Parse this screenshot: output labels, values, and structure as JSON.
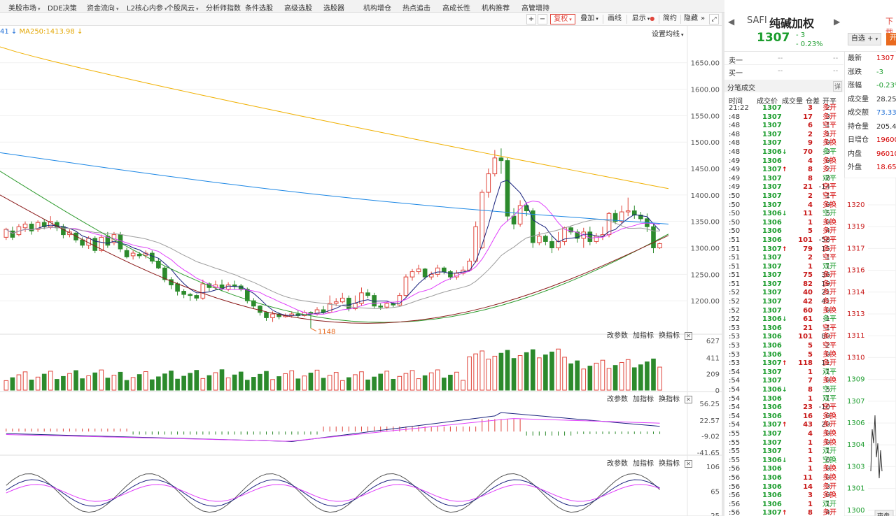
{
  "menu": [
    {
      "label": "美股市场",
      "dropdown": true
    },
    {
      "label": "DDE决策",
      "dropdown": false
    },
    {
      "label": "资金流向",
      "dropdown": true
    },
    {
      "label": "L2核心内参",
      "dropdown": true
    },
    {
      "label": "个股风云",
      "dropdown": true
    },
    {
      "label": "分析师指数",
      "dropdown": false
    },
    {
      "label": "条件选股",
      "dropdown": false
    },
    {
      "label": "高级选股",
      "dropdown": false
    },
    {
      "label": "选股器",
      "dropdown": false
    },
    {
      "label": "机构增仓",
      "dropdown": false
    },
    {
      "label": "热点追击",
      "dropdown": false
    },
    {
      "label": "高成长性",
      "dropdown": false
    },
    {
      "label": "机构推荐",
      "dropdown": false
    },
    {
      "label": "高管增持",
      "dropdown": false
    }
  ],
  "toolbar": {
    "plus": "+",
    "minus": "−",
    "fuquan": "复权",
    "diejia": "叠加",
    "huaxian": "画线",
    "xianshi": "显示",
    "jianyue": "简约",
    "yincang": "隐藏",
    "more": "»",
    "expand": "⤢"
  },
  "chart_header": {
    "ma_prefix": "41",
    "ma250": "MA250:1413.98",
    "set_ma": "设置均线"
  },
  "panel_links": {
    "params": "改参数",
    "add": "加指标",
    "switch": "换指标"
  },
  "quote": {
    "symbol": "SAFI",
    "name": "纯碱加权",
    "price": "1307",
    "change": "- 3",
    "change_pct": "- 0.23%",
    "link": "下载",
    "zixuan": "自选",
    "zixuan_plus": "+",
    "open_btn": "开",
    "sell1_label": "卖一",
    "sell1_price": "--",
    "sell1_vol": "--",
    "buy1_label": "买一",
    "buy1_price": "--",
    "buy1_vol": "--"
  },
  "ticks_panel": {
    "title": "分笔成交",
    "detail": "详",
    "columns": [
      "时间",
      "成交价",
      "成交量",
      "仓差",
      "开平"
    ]
  },
  "ticks": [
    {
      "t": "21:22",
      "p": "1307",
      "v": "3",
      "oi": "2",
      "type": "多开",
      "tc": "up"
    },
    {
      "t": ":48",
      "p": "1307",
      "v": "17",
      "oi": "3",
      "type": "多开",
      "tc": "up"
    },
    {
      "t": ":48",
      "p": "1307",
      "v": "6",
      "oi": "-1",
      "type": "空平",
      "tc": "up"
    },
    {
      "t": ":48",
      "p": "1307",
      "v": "2",
      "oi": "1",
      "type": "多开",
      "tc": "up"
    },
    {
      "t": ":48",
      "p": "1307",
      "v": "9",
      "oi": "0",
      "type": "多换",
      "tc": "up"
    },
    {
      "t": ":48",
      "p": "1306",
      "v": "70",
      "oi": "-3",
      "type": "多平",
      "tc": "down",
      "arrow": "down"
    },
    {
      "t": ":49",
      "p": "1306",
      "v": "4",
      "oi": "0",
      "type": "多换",
      "tc": "up"
    },
    {
      "t": ":49",
      "p": "1307",
      "v": "8",
      "oi": "2",
      "type": "多开",
      "tc": "up",
      "arrow": "up"
    },
    {
      "t": ":49",
      "p": "1307",
      "v": "8",
      "oi": "-8",
      "type": "双平",
      "tc": "down"
    },
    {
      "t": ":49",
      "p": "1307",
      "v": "21",
      "oi": "-14",
      "type": "空平",
      "tc": "up"
    },
    {
      "t": ":50",
      "p": "1307",
      "v": "2",
      "oi": "-1",
      "type": "空平",
      "tc": "up"
    },
    {
      "t": ":50",
      "p": "1307",
      "v": "4",
      "oi": "0",
      "type": "多换",
      "tc": "up"
    },
    {
      "t": ":50",
      "p": "1306",
      "v": "11",
      "oi": "5",
      "type": "空开",
      "tc": "down",
      "arrow": "down"
    },
    {
      "t": ":50",
      "p": "1306",
      "v": "1",
      "oi": "0",
      "type": "多换",
      "tc": "up"
    },
    {
      "t": ":50",
      "p": "1306",
      "v": "5",
      "oi": "4",
      "type": "多开",
      "tc": "up"
    },
    {
      "t": ":51",
      "p": "1306",
      "v": "101",
      "oi": "-58",
      "type": "空平",
      "tc": "up"
    },
    {
      "t": ":51",
      "p": "1307",
      "v": "79",
      "oi": "15",
      "type": "多开",
      "tc": "up",
      "arrow": "up"
    },
    {
      "t": ":51",
      "p": "1307",
      "v": "2",
      "oi": "-1",
      "type": "空平",
      "tc": "up"
    },
    {
      "t": ":51",
      "p": "1307",
      "v": "1",
      "oi": "1",
      "type": "双开",
      "tc": "down"
    },
    {
      "t": ":51",
      "p": "1307",
      "v": "75",
      "oi": "36",
      "type": "多开",
      "tc": "up"
    },
    {
      "t": ":51",
      "p": "1307",
      "v": "82",
      "oi": "19",
      "type": "多开",
      "tc": "up"
    },
    {
      "t": ":52",
      "p": "1307",
      "v": "40",
      "oi": "21",
      "type": "多开",
      "tc": "up"
    },
    {
      "t": ":52",
      "p": "1307",
      "v": "42",
      "oi": "41",
      "type": "多开",
      "tc": "up"
    },
    {
      "t": ":52",
      "p": "1307",
      "v": "60",
      "oi": "0",
      "type": "多换",
      "tc": "up"
    },
    {
      "t": ":52",
      "p": "1306",
      "v": "61",
      "oi": "-1",
      "type": "多平",
      "tc": "down",
      "arrow": "down"
    },
    {
      "t": ":53",
      "p": "1306",
      "v": "21",
      "oi": "-1",
      "type": "空平",
      "tc": "up"
    },
    {
      "t": ":53",
      "p": "1306",
      "v": "101",
      "oi": "80",
      "type": "多开",
      "tc": "up"
    },
    {
      "t": ":53",
      "p": "1306",
      "v": "5",
      "oi": "-2",
      "type": "空平",
      "tc": "up"
    },
    {
      "t": ":53",
      "p": "1306",
      "v": "5",
      "oi": "0",
      "type": "多换",
      "tc": "up"
    },
    {
      "t": ":53",
      "p": "1307",
      "v": "118",
      "oi": "11",
      "type": "多开",
      "tc": "up",
      "arrow": "up"
    },
    {
      "t": ":54",
      "p": "1307",
      "v": "1",
      "oi": "-1",
      "type": "双平",
      "tc": "down"
    },
    {
      "t": ":54",
      "p": "1307",
      "v": "7",
      "oi": "0",
      "type": "多换",
      "tc": "up"
    },
    {
      "t": ":54",
      "p": "1306",
      "v": "8",
      "oi": "5",
      "type": "空开",
      "tc": "down",
      "arrow": "down"
    },
    {
      "t": ":54",
      "p": "1306",
      "v": "1",
      "oi": "-1",
      "type": "双平",
      "tc": "down"
    },
    {
      "t": ":54",
      "p": "1306",
      "v": "23",
      "oi": "-10",
      "type": "空平",
      "tc": "up"
    },
    {
      "t": ":54",
      "p": "1306",
      "v": "16",
      "oi": "0",
      "type": "多换",
      "tc": "up"
    },
    {
      "t": ":54",
      "p": "1307",
      "v": "43",
      "oi": "20",
      "type": "多开",
      "tc": "up",
      "arrow": "up"
    },
    {
      "t": ":55",
      "p": "1307",
      "v": "4",
      "oi": "0",
      "type": "多换",
      "tc": "up"
    },
    {
      "t": ":55",
      "p": "1307",
      "v": "1",
      "oi": "0",
      "type": "多换",
      "tc": "up"
    },
    {
      "t": ":55",
      "p": "1307",
      "v": "1",
      "oi": "1",
      "type": "双开",
      "tc": "down"
    },
    {
      "t": ":55",
      "p": "1306",
      "v": "1",
      "oi": "0",
      "type": "空换",
      "tc": "down",
      "arrow": "down"
    },
    {
      "t": ":56",
      "p": "1306",
      "v": "1",
      "oi": "0",
      "type": "多换",
      "tc": "up"
    },
    {
      "t": ":56",
      "p": "1306",
      "v": "11",
      "oi": "0",
      "type": "多换",
      "tc": "up"
    },
    {
      "t": ":56",
      "p": "1306",
      "v": "14",
      "oi": "3",
      "type": "多开",
      "tc": "up"
    },
    {
      "t": ":56",
      "p": "1306",
      "v": "3",
      "oi": "0",
      "type": "多换",
      "tc": "up"
    },
    {
      "t": ":56",
      "p": "1306",
      "v": "1",
      "oi": "1",
      "type": "双开",
      "tc": "down"
    },
    {
      "t": ":56",
      "p": "1307",
      "v": "8",
      "oi": "4",
      "type": "多开",
      "tc": "up",
      "arrow": "up"
    }
  ],
  "stats": [
    {
      "label": "最新",
      "value": "1307",
      "color": "#d40000"
    },
    {
      "label": "涨跌",
      "value": "-3",
      "color": "#1a9c2c"
    },
    {
      "label": "涨幅",
      "value": "-0.23%",
      "color": "#1a9c2c"
    },
    {
      "label": "成交量",
      "value": "28.25万",
      "color": "#333333"
    },
    {
      "label": "成交额",
      "value": "73.33亿",
      "color": "#1f6fd6"
    },
    {
      "label": "持仓量",
      "value": "205.4万",
      "color": "#333333"
    },
    {
      "label": "日增仓",
      "value": "19600",
      "color": "#d40000"
    },
    {
      "label": "内盘",
      "value": "96010",
      "color": "#d40000"
    },
    {
      "label": "外盘",
      "value": "18.65万",
      "color": "#d40000"
    }
  ],
  "mini_chart": {
    "yticks": [
      "1320",
      "1319",
      "1317",
      "1316",
      "1314",
      "1313",
      "1311",
      "1310",
      "1309",
      "1307",
      "1306",
      "1304",
      "1303",
      "1301",
      "1300"
    ],
    "footer": "52138",
    "night": "夜盘"
  },
  "colors": {
    "up": "#e0463c",
    "down": "#2c8a2c",
    "ma5": "#1a237e",
    "ma10": "#e040fb",
    "ma20": "#9e9e9e",
    "ma30": "#8b1a1a",
    "ma60": "#1e88e5",
    "ma120": "#2e9b2e",
    "ma250": "#f0b000"
  },
  "chart_data": [
    {
      "type": "candlestick",
      "title": "",
      "ylim": [
        1150,
        1680
      ],
      "yticks": [
        "1650.00",
        "1600.00",
        "1550.00",
        "1500.00",
        "1450.00",
        "1400.00",
        "1350.00",
        "1300.00",
        "1250.00",
        "1200.00"
      ],
      "annotation_low": "1148",
      "candles": [
        [
          1320,
          1335,
          1315,
          1338
        ],
        [
          1332,
          1320,
          1315,
          1340
        ],
        [
          1325,
          1340,
          1322,
          1345
        ],
        [
          1338,
          1345,
          1330,
          1350
        ],
        [
          1345,
          1332,
          1325,
          1350
        ],
        [
          1335,
          1348,
          1330,
          1352
        ],
        [
          1348,
          1340,
          1335,
          1355
        ],
        [
          1340,
          1350,
          1335,
          1360
        ],
        [
          1348,
          1338,
          1332,
          1352
        ],
        [
          1340,
          1325,
          1318,
          1345
        ],
        [
          1325,
          1330,
          1320,
          1335
        ],
        [
          1328,
          1315,
          1310,
          1332
        ],
        [
          1315,
          1305,
          1300,
          1320
        ],
        [
          1305,
          1318,
          1298,
          1322
        ],
        [
          1318,
          1295,
          1290,
          1322
        ],
        [
          1295,
          1320,
          1292,
          1325
        ],
        [
          1322,
          1305,
          1300,
          1330
        ],
        [
          1310,
          1325,
          1305,
          1330
        ],
        [
          1325,
          1298,
          1292,
          1330
        ],
        [
          1295,
          1283,
          1280,
          1300
        ],
        [
          1285,
          1290,
          1278,
          1295
        ],
        [
          1288,
          1285,
          1280,
          1292
        ],
        [
          1286,
          1290,
          1280,
          1295
        ],
        [
          1290,
          1275,
          1270,
          1295
        ],
        [
          1275,
          1262,
          1260,
          1280
        ],
        [
          1262,
          1240,
          1235,
          1265
        ],
        [
          1240,
          1230,
          1222,
          1245
        ],
        [
          1232,
          1218,
          1210,
          1235
        ],
        [
          1218,
          1212,
          1205,
          1222
        ],
        [
          1212,
          1210,
          1200,
          1215
        ],
        [
          1210,
          1205,
          1200,
          1212
        ],
        [
          1205,
          1232,
          1202,
          1240
        ],
        [
          1232,
          1225,
          1218,
          1235
        ],
        [
          1225,
          1230,
          1220,
          1238
        ],
        [
          1230,
          1222,
          1218,
          1240
        ],
        [
          1222,
          1230,
          1218,
          1235
        ],
        [
          1230,
          1228,
          1222,
          1238
        ],
        [
          1228,
          1222,
          1218,
          1232
        ],
        [
          1222,
          1200,
          1195,
          1225
        ],
        [
          1200,
          1190,
          1185,
          1205
        ],
        [
          1190,
          1178,
          1172,
          1192
        ],
        [
          1178,
          1168,
          1162,
          1180
        ],
        [
          1168,
          1175,
          1160,
          1180
        ],
        [
          1175,
          1170,
          1165,
          1178
        ],
        [
          1170,
          1172,
          1168,
          1176
        ],
        [
          1172,
          1175,
          1168,
          1180
        ],
        [
          1175,
          1172,
          1168,
          1182
        ],
        [
          1172,
          1178,
          1170,
          1182
        ],
        [
          1178,
          1175,
          1148,
          1180
        ],
        [
          1175,
          1183,
          1172,
          1188
        ],
        [
          1183,
          1178,
          1175,
          1190
        ],
        [
          1178,
          1195,
          1176,
          1210
        ],
        [
          1195,
          1198,
          1190,
          1205
        ],
        [
          1198,
          1205,
          1195,
          1215
        ],
        [
          1205,
          1185,
          1180,
          1210
        ],
        [
          1185,
          1195,
          1182,
          1210
        ],
        [
          1195,
          1215,
          1190,
          1225
        ],
        [
          1215,
          1210,
          1205,
          1222
        ],
        [
          1210,
          1190,
          1185,
          1215
        ],
        [
          1190,
          1188,
          1183,
          1195
        ],
        [
          1188,
          1195,
          1185,
          1198
        ],
        [
          1195,
          1192,
          1188,
          1198
        ],
        [
          1192,
          1210,
          1190,
          1215
        ],
        [
          1210,
          1245,
          1208,
          1250
        ],
        [
          1245,
          1255,
          1238,
          1260
        ],
        [
          1255,
          1260,
          1250,
          1268
        ],
        [
          1260,
          1245,
          1240,
          1262
        ],
        [
          1245,
          1250,
          1240,
          1255
        ],
        [
          1250,
          1262,
          1245,
          1268
        ],
        [
          1262,
          1255,
          1250,
          1265
        ],
        [
          1255,
          1245,
          1240,
          1258
        ],
        [
          1245,
          1252,
          1240,
          1258
        ],
        [
          1252,
          1258,
          1248,
          1265
        ],
        [
          1258,
          1275,
          1255,
          1280
        ],
        [
          1275,
          1340,
          1272,
          1350
        ],
        [
          1300,
          1405,
          1298,
          1410
        ],
        [
          1405,
          1440,
          1395,
          1450
        ],
        [
          1440,
          1470,
          1435,
          1485
        ],
        [
          1470,
          1465,
          1440,
          1488
        ],
        [
          1465,
          1360,
          1350,
          1470
        ],
        [
          1360,
          1345,
          1335,
          1375
        ],
        [
          1345,
          1380,
          1340,
          1390
        ],
        [
          1380,
          1370,
          1360,
          1385
        ],
        [
          1370,
          1310,
          1300,
          1375
        ],
        [
          1310,
          1322,
          1305,
          1330
        ],
        [
          1322,
          1312,
          1305,
          1325
        ],
        [
          1312,
          1300,
          1290,
          1322
        ],
        [
          1300,
          1312,
          1295,
          1330
        ],
        [
          1312,
          1338,
          1305,
          1340
        ],
        [
          1338,
          1330,
          1325,
          1342
        ],
        [
          1330,
          1318,
          1310,
          1335
        ],
        [
          1318,
          1330,
          1300,
          1338
        ],
        [
          1330,
          1312,
          1305,
          1340
        ],
        [
          1312,
          1322,
          1308,
          1328
        ],
        [
          1322,
          1325,
          1315,
          1340
        ],
        [
          1325,
          1365,
          1320,
          1368
        ],
        [
          1365,
          1350,
          1345,
          1372
        ],
        [
          1350,
          1368,
          1345,
          1380
        ],
        [
          1368,
          1370,
          1360,
          1395
        ],
        [
          1370,
          1362,
          1355,
          1380
        ],
        [
          1362,
          1355,
          1350,
          1368
        ],
        [
          1355,
          1340,
          1330,
          1365
        ],
        [
          1340,
          1300,
          1290,
          1345
        ],
        [
          1300,
          1308,
          1298,
          1310
        ]
      ],
      "ma_series": [
        {
          "name": "MA250",
          "color": "#f0b000",
          "values": [
            1680,
            1412
          ]
        },
        {
          "name": "MA120",
          "color": "#1e88e5",
          "values": [
            1480,
            1345
          ]
        },
        {
          "name": "MA60",
          "color": "#2e9b2e",
          "values": [
            1445,
            1260
          ]
        },
        {
          "name": "MA30",
          "color": "#8b1a1a",
          "values": [
            1400,
            1330
          ]
        }
      ]
    },
    {
      "type": "bar",
      "title": "",
      "ylim": [
        0,
        627
      ],
      "yticks": [
        "627",
        "411",
        "209",
        "0"
      ]
    },
    {
      "type": "line",
      "title": "",
      "ylim": [
        -41.65,
        56.25
      ],
      "yticks": [
        "56.25",
        "22.57",
        "-9.02",
        "-41.65"
      ]
    },
    {
      "type": "line",
      "title": "",
      "ylim": [
        25,
        106
      ],
      "yticks": [
        "106",
        "65",
        "25"
      ]
    }
  ]
}
